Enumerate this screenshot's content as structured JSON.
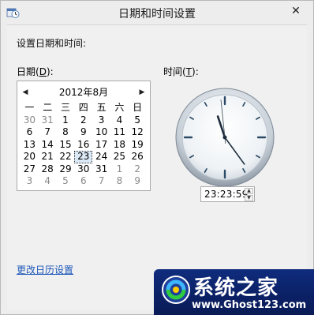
{
  "window": {
    "title": "日期和时间设置",
    "close_symbol": "✕"
  },
  "content": {
    "heading": "设置日期和时间:"
  },
  "date": {
    "label_prefix": "日期(",
    "label_key": "D",
    "label_suffix": "):"
  },
  "time": {
    "label_prefix": "时间(",
    "label_key": "T",
    "label_suffix": "):",
    "value": "23:23:59"
  },
  "calendar": {
    "title": "2012年8月",
    "prev_symbol": "◀",
    "next_symbol": "▶",
    "weekdays": [
      "一",
      "二",
      "三",
      "四",
      "五",
      "六",
      "日"
    ],
    "weeks": [
      [
        "30",
        "31",
        "1",
        "2",
        "3",
        "4",
        "5"
      ],
      [
        "6",
        "7",
        "8",
        "9",
        "10",
        "11",
        "12"
      ],
      [
        "13",
        "14",
        "15",
        "16",
        "17",
        "18",
        "19"
      ],
      [
        "20",
        "21",
        "22",
        "23",
        "24",
        "25",
        "26"
      ],
      [
        "27",
        "28",
        "29",
        "30",
        "31",
        "1",
        "2"
      ],
      [
        "3",
        "4",
        "5",
        "6",
        "7",
        "8",
        "9"
      ]
    ],
    "selected_day": "23"
  },
  "clock": {
    "hours": 23,
    "minutes": 23,
    "seconds": 59
  },
  "links": {
    "change_calendar_settings": "更改日历设置"
  },
  "watermark": {
    "title": "系统之家",
    "url": "www.Ghost123.com"
  },
  "colors": {
    "link": "#1d57b9",
    "watermark_bg": "#0f2c7d"
  }
}
